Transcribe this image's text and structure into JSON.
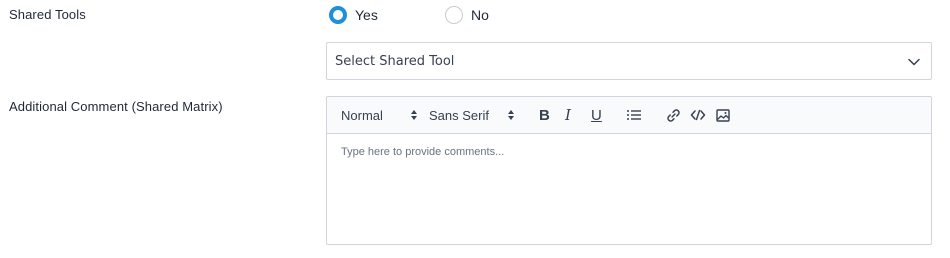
{
  "shared_tools": {
    "label": "Shared Tools",
    "options": [
      {
        "label": "Yes",
        "selected": true
      },
      {
        "label": "No",
        "selected": false
      }
    ],
    "select": {
      "value": "Select Shared Tool",
      "icon": "chevron-down-icon"
    }
  },
  "comment": {
    "label": "Additional Comment (Shared Matrix)",
    "toolbar": {
      "header_format": "Normal",
      "font_family": "Sans Serif",
      "bold": "B",
      "italic": "I",
      "underline": "U",
      "icons": [
        "list-icon",
        "link-icon",
        "code-icon",
        "image-icon"
      ]
    },
    "placeholder": "Type here to provide comments..."
  },
  "colors": {
    "accent": "#1e8fd8",
    "border": "#d1d5db",
    "toolbar_bg": "#f9fafb"
  }
}
